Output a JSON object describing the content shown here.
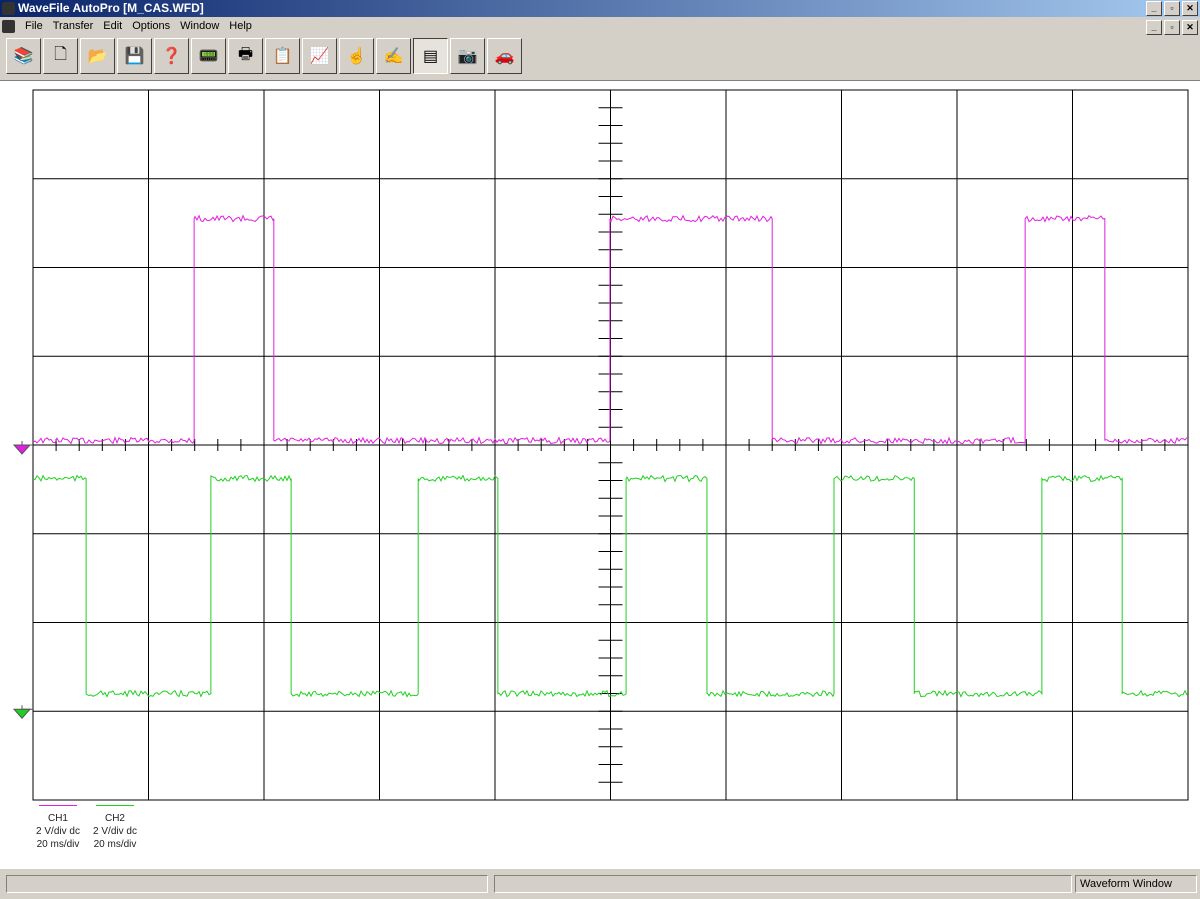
{
  "window": {
    "title": "WaveFile AutoPro [M_CAS.WFD]"
  },
  "menu": [
    "File",
    "Transfer",
    "Edit",
    "Options",
    "Window",
    "Help"
  ],
  "toolbar": [
    {
      "name": "library-icon",
      "glyph": "📚"
    },
    {
      "name": "new-icon",
      "glyph": "🗋"
    },
    {
      "name": "open-folder-icon",
      "glyph": "📂"
    },
    {
      "name": "save-icon",
      "glyph": "💾"
    },
    {
      "name": "scope-help-icon",
      "glyph": "❓"
    },
    {
      "name": "scope-capture-icon",
      "glyph": "📟"
    },
    {
      "name": "print-icon",
      "glyph": "🖶"
    },
    {
      "name": "clipboard-icon",
      "glyph": "📋"
    },
    {
      "name": "waveform-cursor-icon",
      "glyph": "📈"
    },
    {
      "name": "hand-pointer-icon",
      "glyph": "☝"
    },
    {
      "name": "hand-edit-icon",
      "glyph": "✍"
    },
    {
      "name": "table-icon",
      "glyph": "▤",
      "active": true
    },
    {
      "name": "camera-icon",
      "glyph": "📷"
    },
    {
      "name": "car-wrench-icon",
      "glyph": "🚗"
    }
  ],
  "legend": [
    {
      "name": "CH1",
      "scale": "2 V/div dc",
      "time": "20 ms/div",
      "color": "#e020e0"
    },
    {
      "name": "CH2",
      "scale": "2 V/div dc",
      "time": "20 ms/div",
      "color": "#20d020"
    }
  ],
  "status": {
    "pane3": "Waveform Window"
  },
  "chart_data": {
    "type": "line",
    "xlim": [
      0,
      200
    ],
    "xlabel": "ms",
    "divisions_x": 10,
    "divisions_y": 8,
    "series": [
      {
        "name": "CH1",
        "color": "#e020e0",
        "low": 0.1,
        "high": 5.1,
        "start": "low",
        "transitions_ms": [
          27.9,
          41.7,
          99.9,
          128.0,
          171.8,
          185.6
        ]
      },
      {
        "name": "CH2",
        "color": "#20d020",
        "low": 0.35,
        "high": 5.2,
        "start": "high",
        "transitions_ms": [
          9.2,
          30.8,
          44.7,
          66.7,
          80.5,
          102.7,
          116.7,
          138.7,
          152.6,
          174.7,
          188.6
        ]
      }
    ]
  }
}
